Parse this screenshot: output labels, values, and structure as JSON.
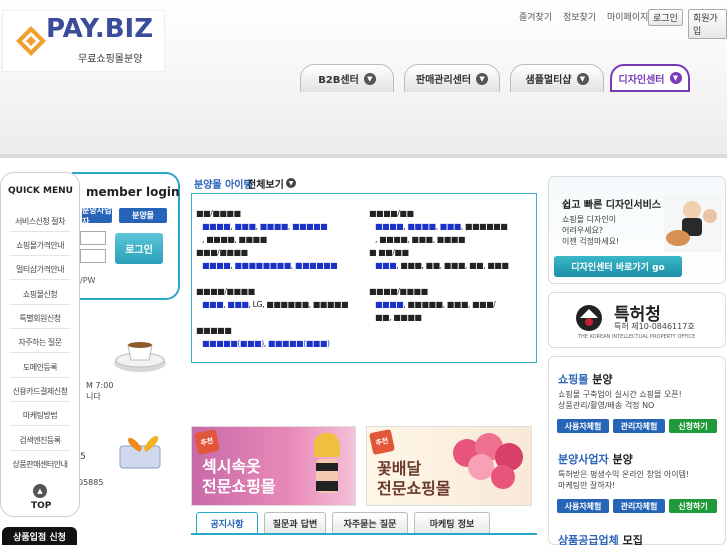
{
  "header": {
    "logo_text": "PAY.BIZ",
    "logo_sub": "무료쇼핑몰분양",
    "top_links": [
      "즐겨찾기",
      "정보찾기",
      "마이페이지"
    ],
    "login_btn": "로그인",
    "join_btn": "회원가입",
    "tabs": [
      "B2B센터",
      "판매관리센터",
      "샘플멀티샵",
      "디자인센터"
    ]
  },
  "quick_menu": {
    "title": "QUICK MENU",
    "items": [
      "서비스신청 절차",
      "쇼핑몰가격안내",
      "멀티샵가격안내",
      "쇼핑몰신청",
      "특별회원신청",
      "자주하는 질문",
      "도메인등록",
      "신용카드결제신청",
      "마케팅방법",
      "검색엔진등록",
      "상품판매센터안내"
    ],
    "top_label": "TOP",
    "bottom_badge": "상품입점 신청"
  },
  "login": {
    "title": "member login",
    "tab_biz": "분양사업자",
    "tab_mall": "분양몰",
    "button": "로그인",
    "pw_label": "/PW",
    "cs_time": "M 7:00",
    "cs_time2": "니다",
    "cs_num": "5",
    "cs_tel": "05885"
  },
  "category": {
    "title": "분양몰 아이템",
    "all": "전체보기",
    "lg_text": "LG"
  },
  "banners": {
    "b1_line1": "섹시속옷",
    "b1_line2": "전문쇼핑몰",
    "b2_line1": "꽃배달",
    "b2_line2": "전문쇼핑몰",
    "ribbon": "추천"
  },
  "center_tabs": [
    "공지사항",
    "질문과 답변",
    "자주묻는 질문",
    "마케팅 정보"
  ],
  "right": {
    "design_title": "쉽고 빠른 디자인서비스",
    "design_text": [
      "쇼핑몰 디자인이",
      "어려우세요?",
      "이젠 걱정마세요!"
    ],
    "design_btn": "디자인센터 바로가기 go",
    "patent_title": "특허청",
    "patent_no": "특허 제10-0846117호",
    "patent_en": "THE KOREAN INTELLECTUAL PROPERTY OFFICE",
    "mall_title": "쇼핑몰",
    "mall_title2": "분양",
    "mall_text": [
      "쇼핑몰 구축업이 실시간 쇼핑몰 오픈!",
      "상품관리/활영/배송 걱정 NO"
    ],
    "btn_user": "사용자체험",
    "btn_admin": "관리자체험",
    "btn_apply": "신청하기",
    "biz_title": "분양사업자",
    "biz_title2": "분양",
    "biz_text": [
      "특허받은 평생수익 온라인 창업 아이템!",
      "마케팅만 잘하자!"
    ],
    "supply_title": "상품공급업체",
    "supply_title2": "모집"
  },
  "colors": {
    "brand_blue": "#2a64b8",
    "accent_cyan": "#2aa6c8",
    "design_purple": "#7a3ab8",
    "logo_orange": "#f0a030"
  }
}
